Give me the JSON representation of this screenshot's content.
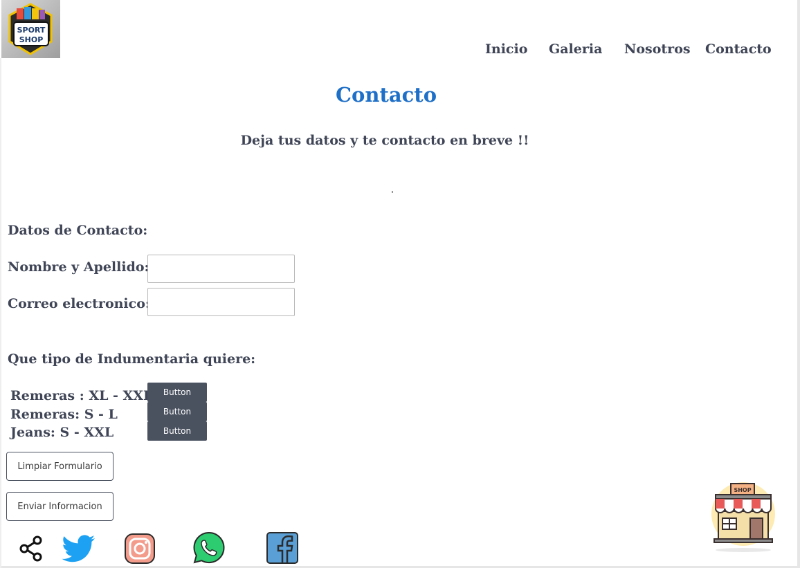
{
  "logo": {
    "text_top": "SPORT",
    "text_bottom": "SHOP"
  },
  "nav": {
    "items": [
      {
        "label": "Inicio"
      },
      {
        "label": "Galeria"
      },
      {
        "label": "Nosotros"
      },
      {
        "label": "Contacto"
      }
    ]
  },
  "main": {
    "title": "Contacto",
    "subtitle": "Deja tus datos y te contacto en breve !!"
  },
  "form": {
    "section_contact": "Datos de Contacto:",
    "name_label": "Nombre y Apellido:",
    "name_value": "",
    "email_label": "Correo electronico:",
    "email_value": "",
    "section_clothing": "Que tipo de Indumentaria quiere:",
    "options": [
      {
        "label": "Remeras : XL - XXL",
        "button": "Button"
      },
      {
        "label": "Remeras: S - L",
        "button": "Button"
      },
      {
        "label": "Jeans: S - XXL",
        "button": "Button"
      }
    ],
    "clear_button": "Limpiar Formulario",
    "submit_button": "Enviar Informacion"
  },
  "social": {
    "icons": [
      "share-icon",
      "twitter-icon",
      "instagram-icon",
      "whatsapp-icon",
      "facebook-icon"
    ]
  },
  "shop_badge": {
    "sign_text": "SHOP"
  },
  "colors": {
    "accent_title": "#1e6fc7",
    "text_dark": "#3f4556",
    "button_dark": "#4a5260",
    "twitter": "#1da1f2",
    "instagram": "#f39c8c",
    "whatsapp": "#2ecc71",
    "facebook": "#5aa0d6"
  }
}
